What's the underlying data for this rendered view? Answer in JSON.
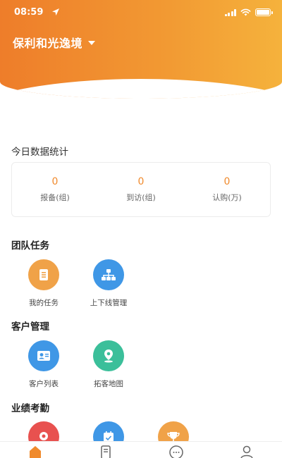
{
  "status_bar": {
    "time": "08:59"
  },
  "header": {
    "project_name": "保利和光逸境"
  },
  "stats": {
    "title": "今日数据统计",
    "items": [
      {
        "value": "0",
        "label": "报备(组)"
      },
      {
        "value": "0",
        "label": "到访(组)"
      },
      {
        "value": "0",
        "label": "认购(万)"
      }
    ]
  },
  "team_tasks": {
    "title": "团队任务",
    "items": [
      {
        "label": "我的任务",
        "icon": "task-list-icon",
        "color": "#f0a248"
      },
      {
        "label": "上下线管理",
        "icon": "org-chart-icon",
        "color": "#3f97e6"
      }
    ]
  },
  "customer_mgmt": {
    "title": "客户管理",
    "items": [
      {
        "label": "客户列表",
        "icon": "contact-card-icon",
        "color": "#3f97e6"
      },
      {
        "label": "拓客地图",
        "icon": "map-pin-icon",
        "color": "#3bbf9a"
      }
    ]
  },
  "performance": {
    "title": "业绩考勤",
    "items": [
      {
        "icon": "location-icon",
        "color": "#e8514f"
      },
      {
        "icon": "calendar-icon",
        "color": "#3f97e6"
      },
      {
        "icon": "trophy-icon",
        "color": "#f0a248"
      }
    ]
  },
  "tabbar": {
    "tabs": [
      {
        "icon": "home-icon"
      },
      {
        "icon": "document-icon"
      },
      {
        "icon": "chat-icon"
      },
      {
        "icon": "profile-icon"
      }
    ]
  },
  "colors": {
    "accent": "#f08a2c",
    "header_start": "#ee7d2a",
    "header_end": "#f5b23c"
  }
}
